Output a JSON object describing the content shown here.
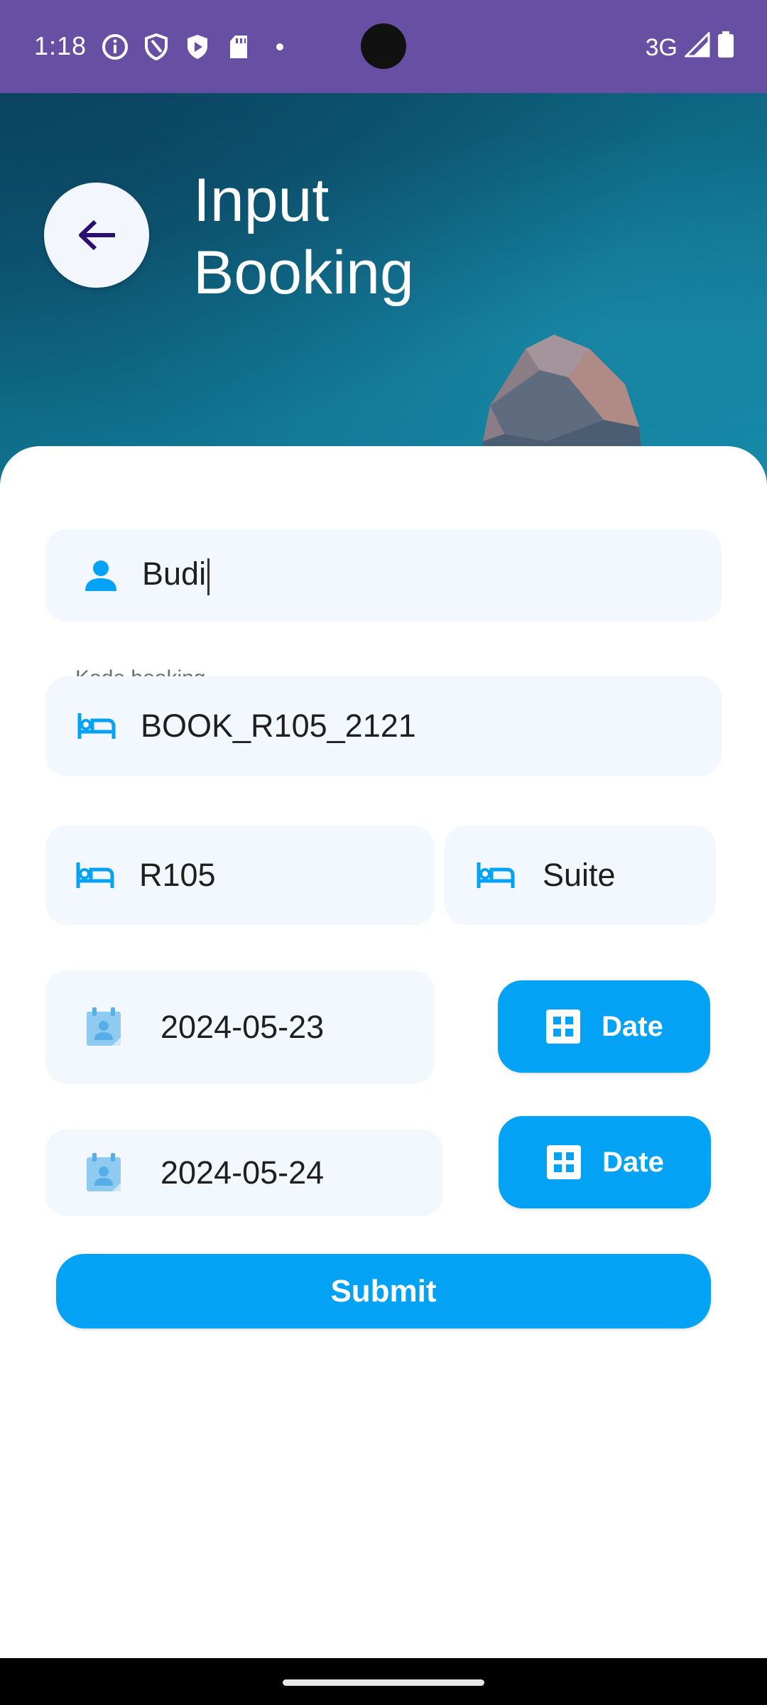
{
  "status_bar": {
    "time": "1:18",
    "network": "3G",
    "icons_left": [
      "info-icon",
      "shield-icon",
      "play-protect-icon",
      "sd-card-icon",
      "dot-icon"
    ],
    "icons_right": [
      "signal-icon",
      "battery-icon"
    ]
  },
  "header": {
    "title": "Input\nBooking",
    "back_icon": "arrow-left-icon"
  },
  "form": {
    "name": {
      "value": "Budi",
      "icon": "person-icon"
    },
    "booking_code": {
      "label": "Kode booking",
      "value": "BOOK_R105_2121",
      "icon": "bed-icon"
    },
    "room_number": {
      "value": "R105",
      "icon": "bed-icon"
    },
    "room_type": {
      "value": "Suite",
      "icon": "bed-icon"
    },
    "check_in": {
      "value": "2024-05-23",
      "icon": "calendar-icon",
      "button_label": "Date",
      "button_icon": "grid-icon"
    },
    "check_out": {
      "value": "2024-05-24",
      "icon": "calendar-icon",
      "button_label": "Date",
      "button_icon": "grid-icon"
    },
    "submit_label": "Submit"
  },
  "colors": {
    "status_bar": "#6750a4",
    "accent": "#03a2f4",
    "field_bg": "#f2f8fd",
    "back_arrow": "#2b0f6e"
  }
}
